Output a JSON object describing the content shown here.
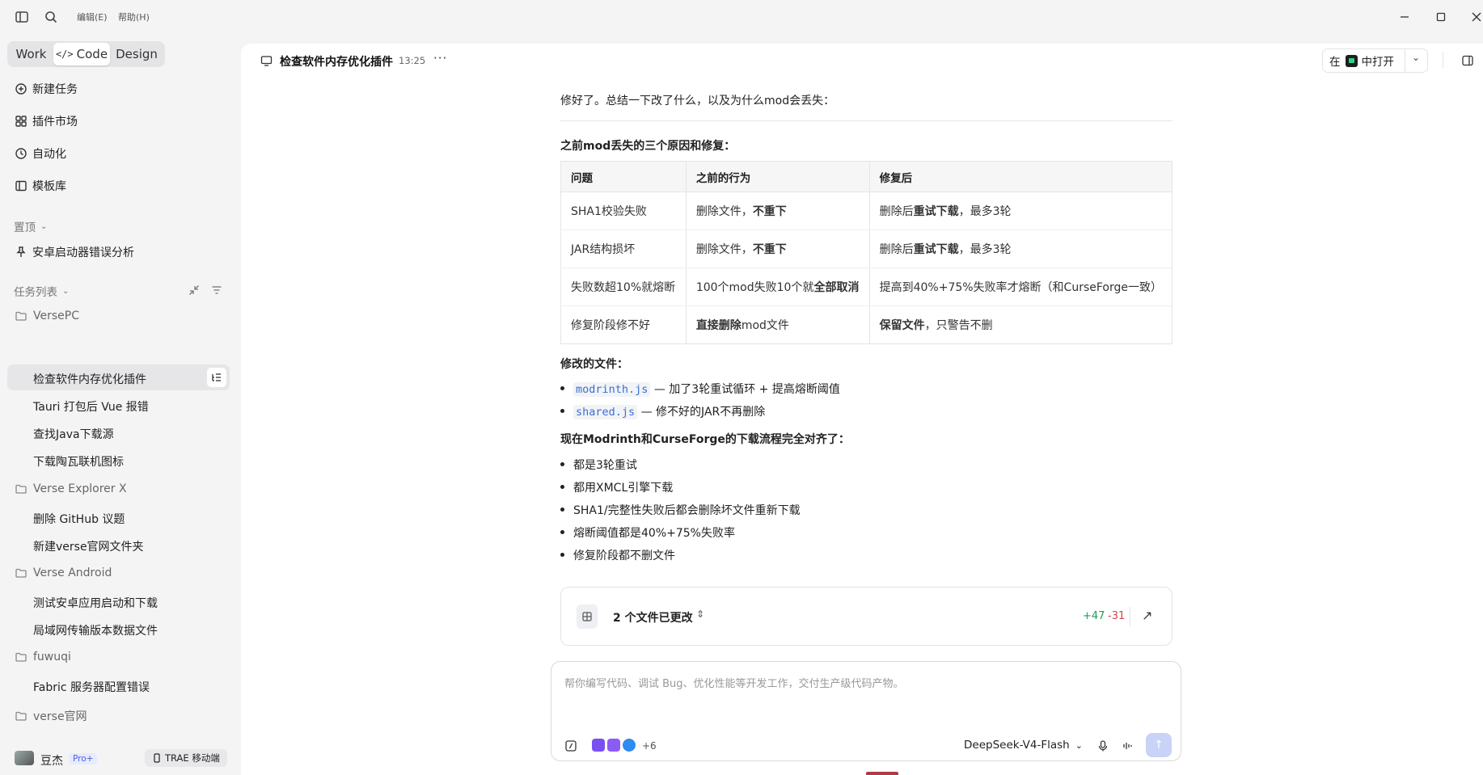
{
  "titlebar": {
    "menu_edit": "编辑(E)",
    "menu_help": "帮助(H)"
  },
  "modes": {
    "work": "Work",
    "code": "Code",
    "design": "Design"
  },
  "nav": [
    {
      "label": "新建任务",
      "icon": "new-task-icon"
    },
    {
      "label": "插件市场",
      "icon": "plugin-market-icon"
    },
    {
      "label": "自动化",
      "icon": "clock-icon"
    },
    {
      "label": "模板库",
      "icon": "template-icon"
    }
  ],
  "pinned": {
    "title": "置顶",
    "items": [
      "安卓启动器错误分析"
    ]
  },
  "task_list": {
    "title": "任务列表",
    "groups": [
      {
        "name": "VersePC",
        "tasks": [
          "检查软件内存优化插件",
          "Tauri 打包后 Vue 报错",
          "查找Java下载源",
          "下载陶瓦联机图标"
        ]
      },
      {
        "name": "Verse Explorer X",
        "tasks": [
          "删除 GitHub 议题",
          "新建verse官网文件夹"
        ]
      },
      {
        "name": "Verse Android",
        "tasks": [
          "测试安卓应用启动和下载",
          "局域网传输版本数据文件"
        ]
      },
      {
        "name": "fuwuqi",
        "tasks": [
          "Fabric 服务器配置错误"
        ]
      },
      {
        "name": "verse官网",
        "tasks": []
      }
    ]
  },
  "user": {
    "name": "豆杰",
    "badge": "Pro+",
    "mobile": "TRAE 移动端"
  },
  "header": {
    "title": "检查软件内存优化插件",
    "time": "13:25",
    "open_prefix": "在",
    "open_label": "中打开"
  },
  "message": {
    "intro": "修好了。总结一下改了什么，以及为什么mod会丢失：",
    "heading1": "之前mod丢失的三个原因和修复：",
    "table": {
      "headers": [
        "问题",
        "之前的行为",
        "修复后"
      ],
      "rows": [
        {
          "problem": "SHA1校验失败",
          "before_a": "删除文件，",
          "before_b": "不重下",
          "before_c": "",
          "after_a": "删除后",
          "after_b": "重试下载",
          "after_c": "，最多3轮"
        },
        {
          "problem": "JAR结构损坏",
          "before_a": "删除文件，",
          "before_b": "不重下",
          "before_c": "",
          "after_a": "删除后",
          "after_b": "重试下载",
          "after_c": "，最多3轮"
        },
        {
          "problem": "失败数超10%就熔断",
          "before_a": "100个mod失败10个就",
          "before_b": "全部取消",
          "before_c": "",
          "after_a": "提高到40%+75%失败率才熔断（和CurseForge一致）",
          "after_b": "",
          "after_c": ""
        },
        {
          "problem": "修复阶段修不好",
          "before_a": "",
          "before_b": "直接删除",
          "before_c": "mod文件",
          "after_a": "",
          "after_b": "保留文件",
          "after_c": "，只警告不删"
        }
      ]
    },
    "heading2": "修改的文件：",
    "files": [
      {
        "name": "modrinth.js",
        "desc": "— 加了3轮重试循环 + 提高熔断阈值"
      },
      {
        "name": "shared.js",
        "desc": "— 修不好的JAR不再删除"
      }
    ],
    "heading3": "现在Modrinth和CurseForge的下载流程完全对齐了：",
    "bullets": [
      "都是3轮重试",
      "都用XMCL引擎下载",
      "SHA1/完整性失败后都会删除坏文件重新下载",
      "熔断阈值都是40%+75%失败率",
      "修复阶段都不删文件"
    ]
  },
  "changes": {
    "label": "2 个文件已更改",
    "added": "+47",
    "removed": "-31"
  },
  "composer": {
    "placeholder": "帮你编写代码、调试 Bug、优化性能等开发工作，交付生产级代码产物。",
    "extra_count": "+6",
    "model": "DeepSeek-V4-Flash"
  },
  "colors": {
    "added": "#1f9d55",
    "removed": "#d64545",
    "accent": "#2f6feb"
  }
}
